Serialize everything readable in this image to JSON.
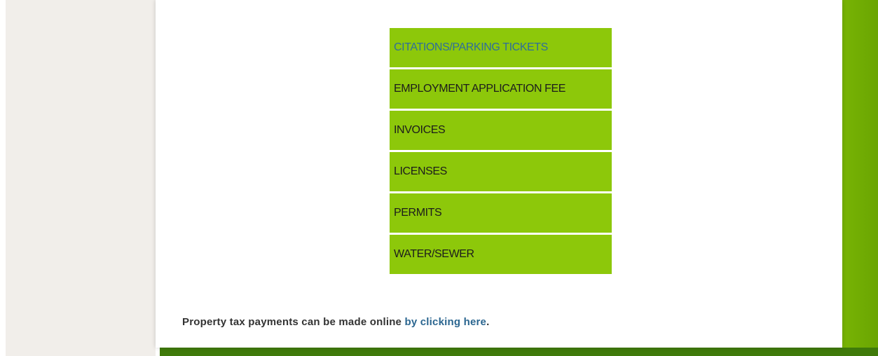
{
  "payment_menu": {
    "items": [
      {
        "label": "CITATIONS/PARKING TICKETS",
        "active": true
      },
      {
        "label": "EMPLOYMENT APPLICATION FEE",
        "active": false
      },
      {
        "label": "INVOICES",
        "active": false
      },
      {
        "label": "LICENSES",
        "active": false
      },
      {
        "label": "PERMITS",
        "active": false
      },
      {
        "label": "WATER/SEWER",
        "active": false
      }
    ]
  },
  "footer": {
    "text": "Property tax payments can be made online",
    "link_label": "by clicking here",
    "period": "."
  },
  "colors": {
    "menu_background": "#8dc80a",
    "active_text": "#2f6e9a",
    "link": "#2b6690",
    "sidebar": "#f1eeea",
    "accent_band": "#78b404"
  }
}
